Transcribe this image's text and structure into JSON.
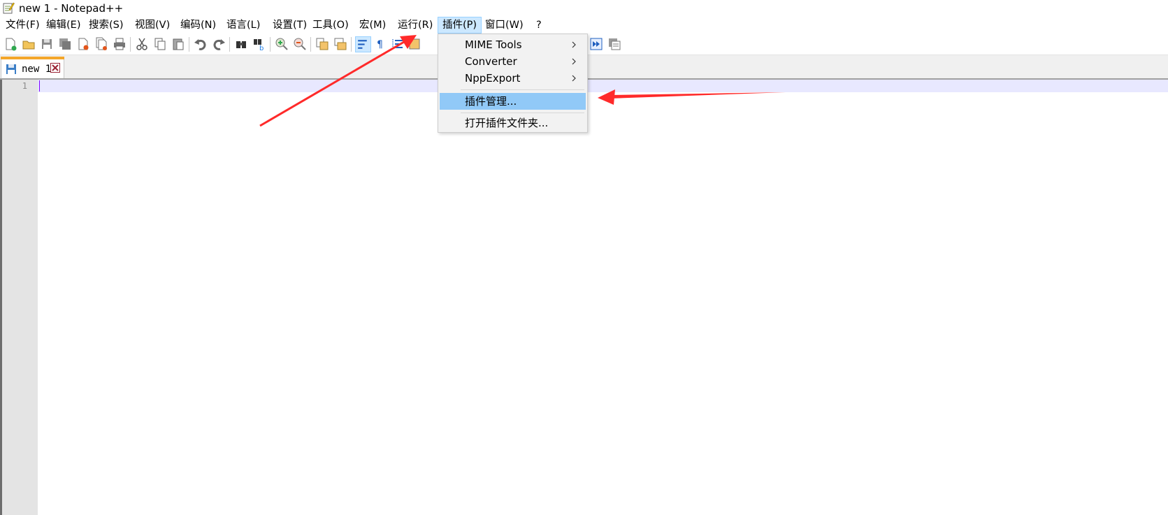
{
  "window": {
    "title": "new 1 - Notepad++"
  },
  "menubar": {
    "items": [
      {
        "label": "文件(F)"
      },
      {
        "label": "编辑(E)"
      },
      {
        "label": "搜索(S)"
      },
      {
        "label": "视图(V)"
      },
      {
        "label": "编码(N)"
      },
      {
        "label": "语言(L)"
      },
      {
        "label": "设置(T)"
      },
      {
        "label": "工具(O)"
      },
      {
        "label": "宏(M)"
      },
      {
        "label": "运行(R)"
      },
      {
        "label": "插件(P)"
      },
      {
        "label": "窗口(W)"
      },
      {
        "label": "?"
      }
    ],
    "active": "插件(P)"
  },
  "tabs": [
    {
      "label": "new 1"
    }
  ],
  "editor": {
    "line_numbers": [
      "1"
    ]
  },
  "plugins_menu": {
    "items": [
      {
        "label": "MIME Tools",
        "submenu": true
      },
      {
        "label": "Converter",
        "submenu": true
      },
      {
        "label": "NppExport",
        "submenu": true
      },
      {
        "label": "插件管理...",
        "submenu": false
      },
      {
        "label": "打开插件文件夹...",
        "submenu": false
      }
    ],
    "highlighted": "插件管理..."
  },
  "colors": {
    "menu_active_bg": "#cce8ff",
    "menu_highlight_bg": "#91c9f7",
    "tab_accent": "#f4a62a",
    "current_line": "#e8e8ff",
    "annotation_arrow": "#ff2a2a"
  }
}
